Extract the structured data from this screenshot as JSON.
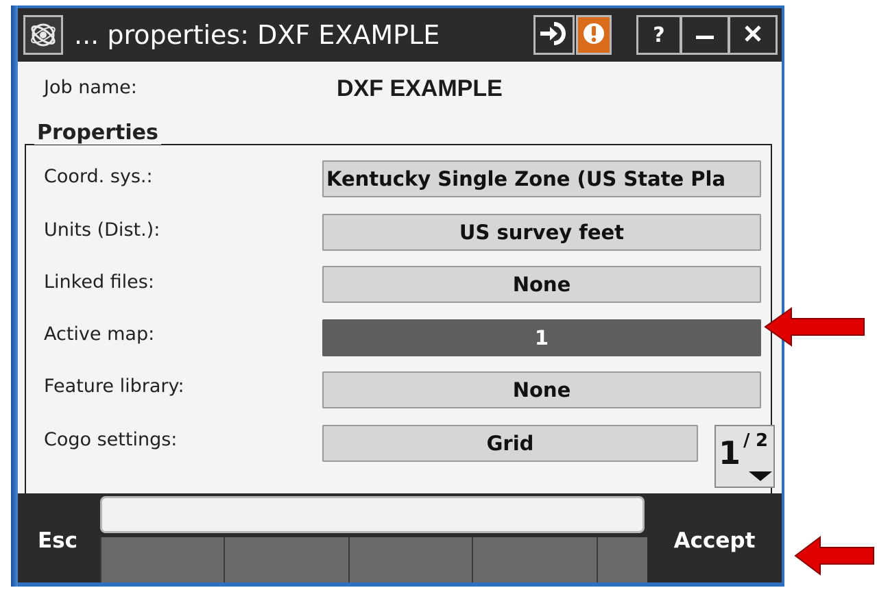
{
  "window": {
    "title": "... properties: DXF EXAMPLE"
  },
  "titlebar_buttons": {
    "help_label": "?"
  },
  "job": {
    "label": "Job name:",
    "value": "DXF EXAMPLE"
  },
  "properties": {
    "group_title": "Properties",
    "rows": [
      {
        "label": "Coord. sys.:",
        "value": "Kentucky Single Zone (US State Pla",
        "active": false
      },
      {
        "label": "Units (Dist.):",
        "value": "US survey feet",
        "active": false
      },
      {
        "label": "Linked files:",
        "value": "None",
        "active": false
      },
      {
        "label": "Active map:",
        "value": "1",
        "active": true
      },
      {
        "label": "Feature library:",
        "value": "None",
        "active": false
      },
      {
        "label": "Cogo settings:",
        "value": "Grid",
        "active": false
      }
    ]
  },
  "pager": {
    "current": "1",
    "separator": "/",
    "total": "2"
  },
  "softkeys": {
    "esc_label": "Esc",
    "accept_label": "Accept"
  },
  "colors": {
    "titlebar": "#2b2b2b",
    "alert_button": "#d96d1c",
    "active_field": "#5e5e5e",
    "field": "#d6d6d6",
    "annotation_arrow": "#e00000",
    "frame": "#2f6fc1"
  }
}
